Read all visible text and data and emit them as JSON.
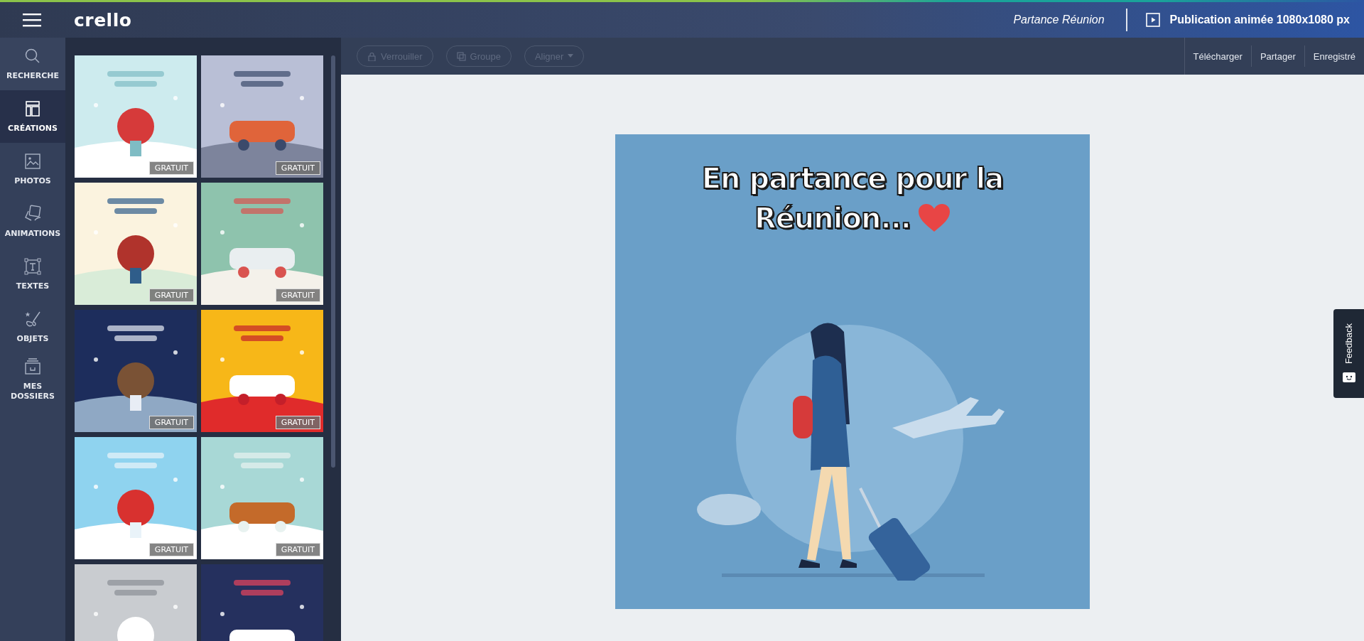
{
  "top_bar": {
    "logo": "crello",
    "project_name": "Partance Réunion",
    "format": "Publication animée 1080x1080 px"
  },
  "sidebar": {
    "items": [
      {
        "kind": "search",
        "label": "RECHERCHE",
        "selected": false
      },
      {
        "kind": "templates",
        "label": "CRÉATIONS",
        "selected": true
      },
      {
        "kind": "photos",
        "label": "PHOTOS",
        "selected": false
      },
      {
        "kind": "animations",
        "label": "ANIMATIONS",
        "selected": false
      },
      {
        "kind": "texts",
        "label": "TEXTES",
        "selected": false
      },
      {
        "kind": "objects",
        "label": "OBJETS",
        "selected": false
      },
      {
        "kind": "folders",
        "label": "MES DOSSIERS",
        "selected": false
      }
    ]
  },
  "templates": [
    {
      "kind": "picture",
      "badge": "GRATUIT"
    },
    {
      "kind": "picture",
      "badge": "GRATUIT"
    },
    {
      "kind": "picture",
      "badge": "GRATUIT"
    },
    {
      "kind": "picture",
      "badge": "GRATUIT"
    },
    {
      "kind": "picture",
      "badge": "GRATUIT"
    },
    {
      "kind": "picture",
      "badge": "GRATUIT"
    },
    {
      "kind": "picture",
      "badge": "GRATUIT"
    },
    {
      "kind": "picture",
      "badge": "GRATUIT"
    },
    {
      "kind": "picture"
    },
    {
      "kind": "picture"
    }
  ],
  "toolbar": {
    "buttons": [
      {
        "kind": "lock",
        "label": "Verrouiller",
        "disabled": true
      },
      {
        "kind": "group",
        "label": "Groupe",
        "disabled": true
      },
      {
        "kind": "align",
        "label": "Aligner",
        "disabled": true,
        "menu": true
      }
    ],
    "actions": [
      "Télécharger",
      "Partager",
      "Enregistré"
    ]
  },
  "design": {
    "title_lines": [
      "En partance pour la",
      "Réunion..."
    ]
  },
  "feedback": {
    "label": "Feedback"
  }
}
